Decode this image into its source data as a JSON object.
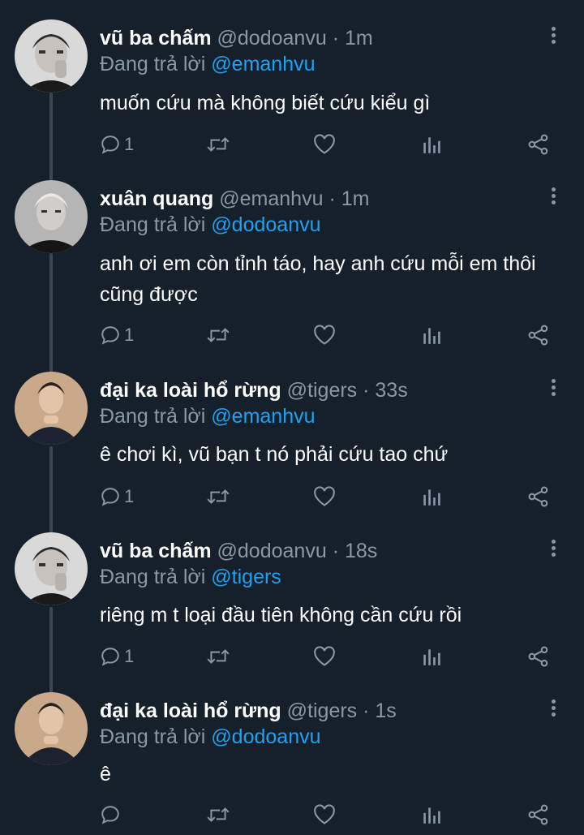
{
  "colors": {
    "background": "#15202b",
    "text": "#ffffff",
    "muted": "#8899a6",
    "link": "#1da1f2"
  },
  "icons": [
    "reply-icon",
    "retweet-icon",
    "like-icon",
    "analytics-icon",
    "share-icon",
    "more-icon"
  ],
  "tweets": [
    {
      "name": "vũ ba chấm",
      "handle": "@dodoanvu",
      "dot": "·",
      "time": "1m",
      "reply_prefix": "Đang trả lời",
      "reply_to": "@emanhvu",
      "text": "muốn cứu mà không biết cứu kiểu gì",
      "reply_count": "1"
    },
    {
      "name": "xuân quang",
      "handle": "@emanhvu",
      "dot": "·",
      "time": "1m",
      "reply_prefix": "Đang trả lời",
      "reply_to": "@dodoanvu",
      "text": "anh ơi em còn tỉnh táo, hay anh cứu mỗi em thôi cũng được",
      "reply_count": "1"
    },
    {
      "name": "đại ka loài hổ rừng",
      "handle": "@tigers",
      "dot": "·",
      "time": "33s",
      "reply_prefix": "Đang trả lời",
      "reply_to": "@emanhvu",
      "text": "ê chơi kì, vũ bạn t nó phải cứu tao chứ",
      "reply_count": "1"
    },
    {
      "name": "vũ ba chấm",
      "handle": "@dodoanvu",
      "dot": "·",
      "time": "18s",
      "reply_prefix": "Đang trả lời",
      "reply_to": "@tigers",
      "text": "riêng m t loại đầu tiên không cần cứu rồi",
      "reply_count": "1"
    },
    {
      "name": "đại ka loài hổ rừng",
      "handle": "@tigers",
      "dot": "·",
      "time": "1s",
      "reply_prefix": "Đang trả lời",
      "reply_to": "@dodoanvu",
      "text": "ê",
      "reply_count": ""
    }
  ]
}
